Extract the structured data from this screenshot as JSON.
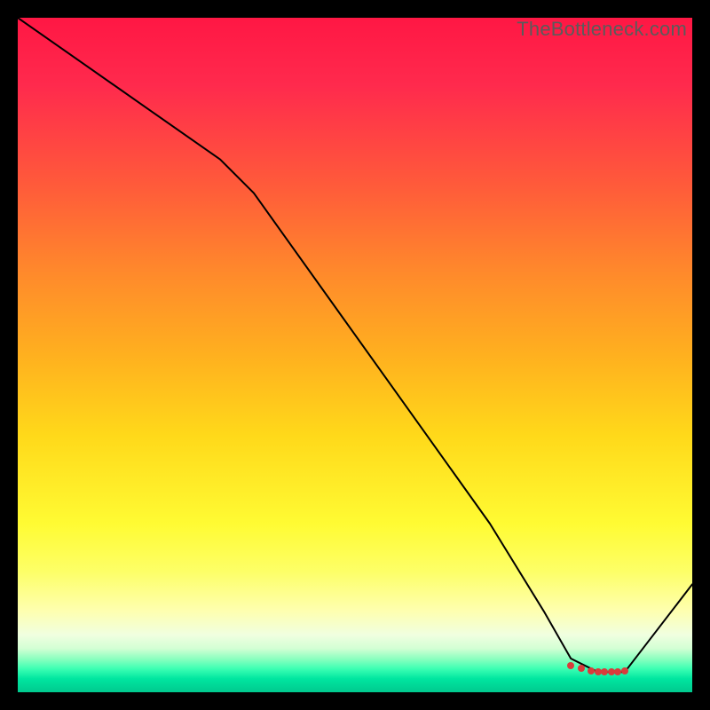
{
  "watermark": "TheBottleneck.com",
  "chart_data": {
    "type": "line",
    "title": "",
    "xlabel": "",
    "ylabel": "",
    "xlim": [
      0,
      100
    ],
    "ylim": [
      0,
      100
    ],
    "grid": false,
    "series": [
      {
        "name": "curve",
        "x": [
          0,
          10,
          20,
          30,
          35,
          40,
          50,
          60,
          70,
          78,
          82,
          86,
          88,
          90,
          100
        ],
        "values": [
          100,
          93,
          86,
          79,
          74,
          67,
          53,
          39,
          25,
          12,
          5,
          3,
          3,
          3,
          16
        ]
      }
    ],
    "markers": {
      "name": "optimal-range-dots",
      "x": [
        82,
        83.5,
        85,
        86,
        87,
        88,
        89,
        90
      ],
      "y": [
        4,
        3.5,
        3.2,
        3,
        3,
        3,
        3,
        3.2
      ]
    },
    "background_gradient": {
      "top": "#ff1744",
      "mid": "#ffd91a",
      "bottom": "#00c98e"
    }
  }
}
